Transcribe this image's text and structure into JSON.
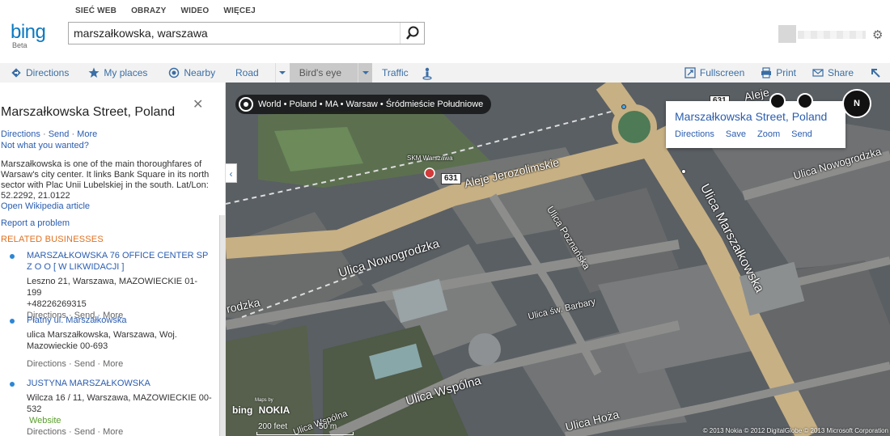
{
  "header": {
    "logo": "bing",
    "logo_sub": "Beta",
    "nav": [
      "SIEĆ WEB",
      "OBRAZY",
      "WIDEO",
      "WIĘCEJ"
    ],
    "search_value": "marszałkowska, warszawa"
  },
  "toolbar": {
    "left": [
      "Directions",
      "My places",
      "Nearby"
    ],
    "road": "Road",
    "birds_eye": "Bird's eye",
    "traffic": "Traffic",
    "right": [
      "Fullscreen",
      "Print",
      "Share"
    ]
  },
  "panel": {
    "title": "Marszałkowska Street, Poland",
    "actions": [
      "Directions",
      "Send",
      "More"
    ],
    "not_wanted": "Not what you wanted?",
    "description": "Marszałkowska is one of the main thoroughfares of Warsaw's city center. It links Bank Square in its north sector with Plac Unii Lubelskiej in the south. Lat/Lon: 52.2292, 21.0122",
    "wiki": "Open Wikipedia article",
    "report": "Report a problem",
    "related_heading": "RELATED BUSINESSES",
    "businesses": [
      {
        "name": "MARSZAŁKOWSKA 76 OFFICE CENTER SP Z O O [ W LIKWIDACJI ]",
        "address": "Leszno 21, Warszawa, MAZOWIECKIE 01-199",
        "phone": "+48226269315",
        "actions": "Directions · Send · More"
      },
      {
        "name": "Płatny ul. Marszałkowska",
        "address": "ulica Marszałkowska, Warszawa, Woj. Mazowieckie 00-693",
        "actions": "Directions · Send · More"
      },
      {
        "name": "JUSTYNA MARSZAŁKOWSKA",
        "address": "Wilcza 16 / 11, Warszawa, MAZOWIECKIE 00-532",
        "website": "Website",
        "actions": "Directions · Send · More"
      }
    ]
  },
  "map": {
    "breadcrumb": "World • Poland • MA • Warsaw • Śródmieście Południowe",
    "infobox_title": "Marszałkowska Street, Poland",
    "infobox_actions": [
      "Directions",
      "Save",
      "Zoom",
      "Send"
    ],
    "compass": "N",
    "route_number": "631",
    "station": "SKM Warszawa",
    "streets": {
      "jerozolimskie": "Aleje Jerozolimskie",
      "marszalkowska": "Ulica Marszałkowska",
      "poznanska": "Ulica Poznańska",
      "nowogrodzka": "Ulica Nowogrodzka",
      "nowogrodzka_right": "Ulica Nowogrodzka",
      "barbary": "Ulica św. Barbary",
      "wspolna": "Ulica Wspólna",
      "wspolna_small": "Ulica Wspólna",
      "hoza": "Ulica Hoża",
      "dzka": "rodzka",
      "aleje_top": "Aleje"
    },
    "scale_ft": "200 feet",
    "scale_m": "50 m",
    "logo": "bing",
    "logo_nokia": "NOKIA",
    "maps_by": "Maps by",
    "copyright": "© 2013 Nokia   © 2012 DigitalGlobe   © 2013 Microsoft Corporation"
  }
}
